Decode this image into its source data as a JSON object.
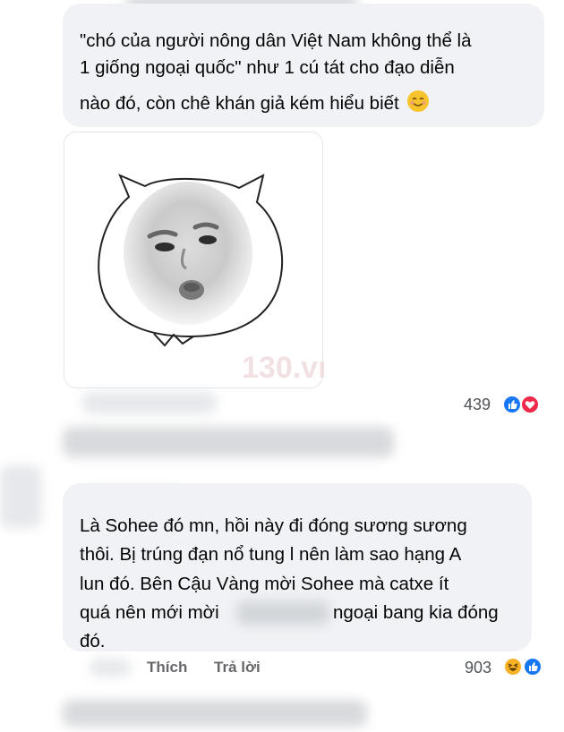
{
  "comment1": {
    "text": "\"chó của người nông dân Việt Nam không thể là 1 giống ngoại quốc\" như 1 cú tát cho đạo diễn nào đó, còn chê khán giả kém hiểu biết 😊",
    "lines": [
      "\"chó của người nông dân Việt Nam không thể là",
      "1 giống ngoại quốc\" như 1 cú tát cho đạo diễn",
      "nào đó, còn chê khán giả kém hiểu biết"
    ],
    "emoji": "😊",
    "sticker_watermark": "130.vn",
    "reaction_count": "439",
    "reactions": [
      "like-icon",
      "love-icon"
    ]
  },
  "comment2": {
    "lines": [
      "Là Sohee đó mn, hồi này đi đóng sương sương",
      "thôi. Bị trúng đạn nổ tung l nên làm sao hạng A",
      "lun đó. Bên Cậu Vàng mời Sohee mà catxe ít",
      "quá nên mới mời",
      "ngoại bang kia đóng",
      "đó."
    ],
    "actions": {
      "like": "Thích",
      "reply": "Trả lời"
    },
    "reaction_count": "903",
    "reactions": [
      "haha-icon",
      "like-icon"
    ]
  },
  "colors": {
    "bubble": "#f0f2f5",
    "meta_text": "#65676b",
    "like": "#1877f2",
    "love": "#f0284a",
    "haha": "#f7b125"
  }
}
